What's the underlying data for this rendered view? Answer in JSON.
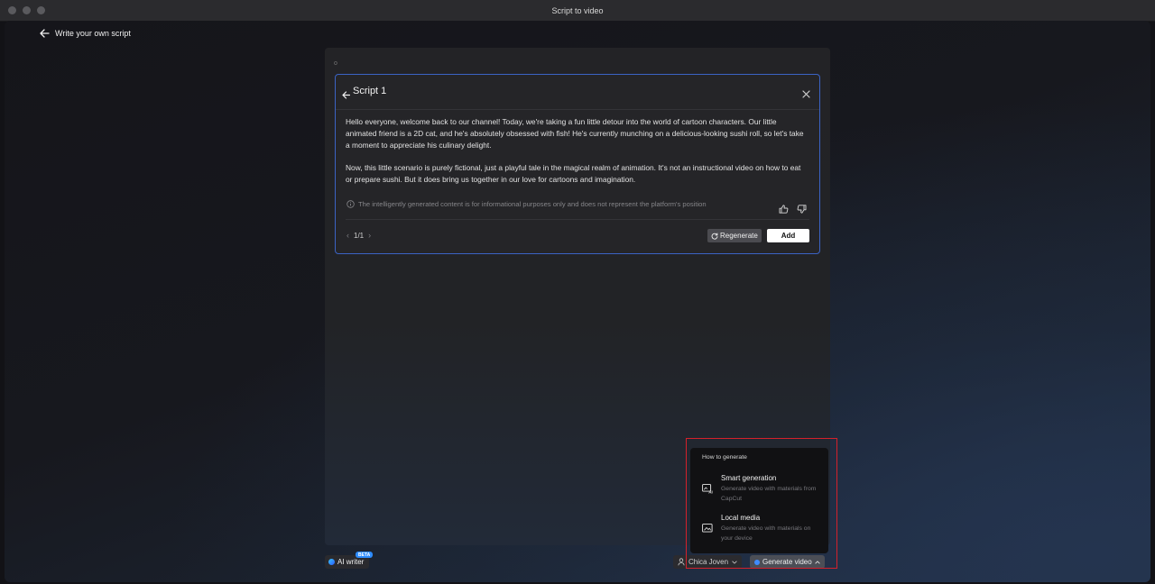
{
  "window": {
    "title": "Script to video"
  },
  "header": {
    "back_label": "Write your own script"
  },
  "editor": {
    "cursor_text": "o"
  },
  "script_card": {
    "title": "Script 1",
    "paragraphs": [
      "Hello everyone, welcome back to our channel! Today, we're taking a fun little detour into the world of cartoon characters. Our little animated friend is a 2D cat, and he's absolutely obsessed with fish! He's currently munching on a delicious-looking sushi roll, so let's take a moment to appreciate his culinary delight.",
      "Now, this little scenario is purely fictional, just a playful tale in the magical realm of animation. It's not an instructional video on how to eat or prepare sushi. But it does bring us together in our love for cartoons and imagination."
    ],
    "disclaimer": "The intelligently generated content is for informational purposes only and does not represent the platform's position",
    "pager": "1/1",
    "regenerate_label": "Regenerate",
    "add_label": "Add"
  },
  "bottom_bar": {
    "ai_writer_label": "AI writer",
    "beta_badge": "BETA",
    "voice_label": "Chica Joven",
    "generate_label": "Generate video"
  },
  "generate_menu": {
    "title": "How to generate",
    "options": [
      {
        "title": "Smart generation",
        "description": "Generate video with materials from CapCut",
        "icon": "smart-generation-icon"
      },
      {
        "title": "Local media",
        "description": "Generate video with materials on your device",
        "icon": "local-media-icon"
      }
    ]
  },
  "colors": {
    "accent_border": "#3b63c4",
    "highlight": "#d4212b",
    "beta_badge": "#2d8cff"
  }
}
